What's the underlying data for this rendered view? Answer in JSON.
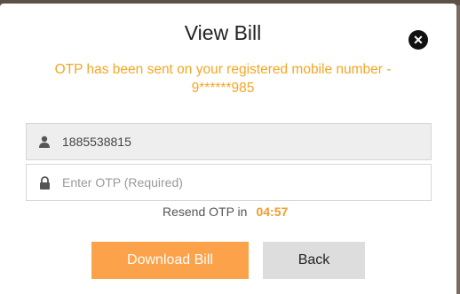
{
  "dialog": {
    "title": "View Bill",
    "close_icon": "close-icon",
    "otp_message": "OTP has been sent on your registered mobile number - 9******985"
  },
  "form": {
    "mobile_value": "1885538815",
    "mobile_icon": "user-icon",
    "otp_placeholder": "Enter OTP (Required)",
    "otp_icon": "lock-icon"
  },
  "resend": {
    "label": "Resend OTP in",
    "timer": "04:57"
  },
  "buttons": {
    "download_label": "Download Bill",
    "back_label": "Back"
  },
  "colors": {
    "accent": "#fca24a",
    "message": "#f5a623"
  }
}
